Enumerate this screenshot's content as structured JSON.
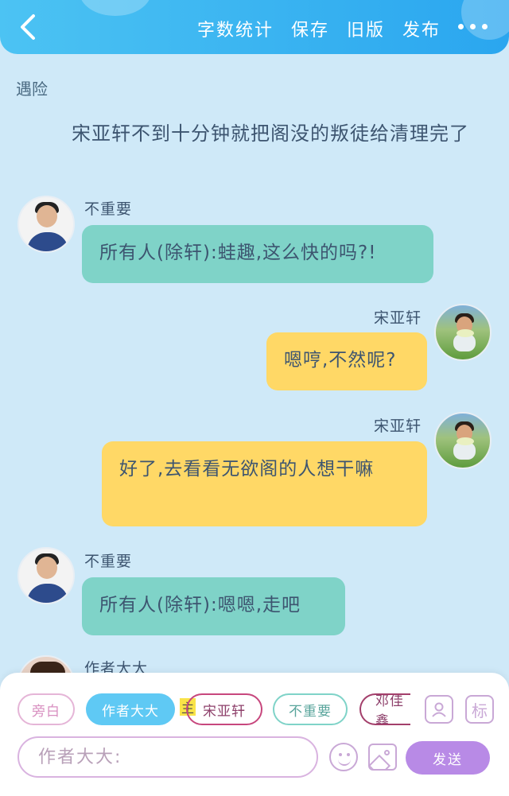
{
  "header": {
    "actions": [
      "字数统计",
      "保存",
      "旧版",
      "发布"
    ],
    "back_icon": "chevron-left-icon",
    "more_icon": "more-dots-icon"
  },
  "document": {
    "title": "遇险",
    "narration": "宋亚轩不到十分钟就把阁没的叛徒给清理完了"
  },
  "messages": [
    {
      "speaker": "不重要",
      "text": "所有人(除轩):蛙趣,这么快的吗?!",
      "side": "left",
      "color": "#7fd3c8"
    },
    {
      "speaker": "宋亚轩",
      "text": "嗯哼,不然呢?",
      "side": "right",
      "color": "#ffd866"
    },
    {
      "speaker": "宋亚轩",
      "text": "好了,去看看无欲阁的人想干嘛",
      "side": "right",
      "color": "#ffd866"
    },
    {
      "speaker": "不重要",
      "text": "所有人(除轩):嗯嗯,走吧",
      "side": "left",
      "color": "#7fd3c8"
    },
    {
      "speaker": "作者大大",
      "partial": true
    }
  ],
  "bottom": {
    "chips": [
      "旁白",
      "作者大大",
      "宋亚轩",
      "不重要",
      "邓佳鑫"
    ],
    "main_badge": "主",
    "role_icon": "person-icon",
    "tag_label": "标",
    "input_placeholder": "作者大大:",
    "send_label": "发送",
    "emoji_icon": "emoji-icon",
    "image_icon": "image-icon"
  }
}
